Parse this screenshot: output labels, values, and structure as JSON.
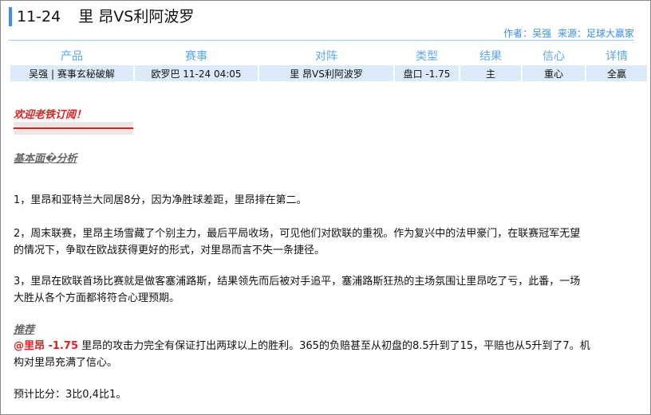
{
  "header": {
    "date": "11-24",
    "match_title": "里 昂VS利阿波罗",
    "author_label": "作者：吴强",
    "source_label": "来源：足球大赢家"
  },
  "table": {
    "headers": [
      "产品",
      "赛事",
      "对阵",
      "类型",
      "结果",
      "信心",
      "详情"
    ],
    "row": [
      "吴强 | 赛事玄秘破解",
      "欧罗巴 11-24 04:05",
      "里 昂VS利阿波罗",
      "盘口 -1.75",
      "主",
      "重心",
      "全赢"
    ]
  },
  "article": {
    "welcome": "欢迎老铁订阅！",
    "basic_title": "基本面�分析",
    "p1": "1，里昂和亚特兰大同居8分，因为净胜球差距，里昂排在第二。",
    "p2_line1": "2，周末联赛，里昂主场雪藏了个别主力，最后平局收场，可见他们对欧联的重视。作为复兴中的法甲豪门，在联赛冠军无望",
    "p2_line2": "的情况下，争取在欧战获得更好的形式，对里昂而言不失一条捷径。",
    "p3_line1": "3，里昂在欧联首场比赛就是做客塞浦路斯，结果领先而后被对手追平，塞浦路斯狂热的主场氛围让里昂吃了亏，此番，一场",
    "p3_line2": "大胜从各个方面都将符合心理预期。",
    "recommend_title": "推荐",
    "pick": "@里昂 -1.75",
    "rec_line1": " 里昂的攻击力完全有保证打出两球以上的胜利。365的负赔甚至从初盘的8.5升到了15，平赔也从5升到了7。机",
    "rec_line2": "构对里昂充满了信心。",
    "score": "预计比分：3比0,4比1。"
  }
}
